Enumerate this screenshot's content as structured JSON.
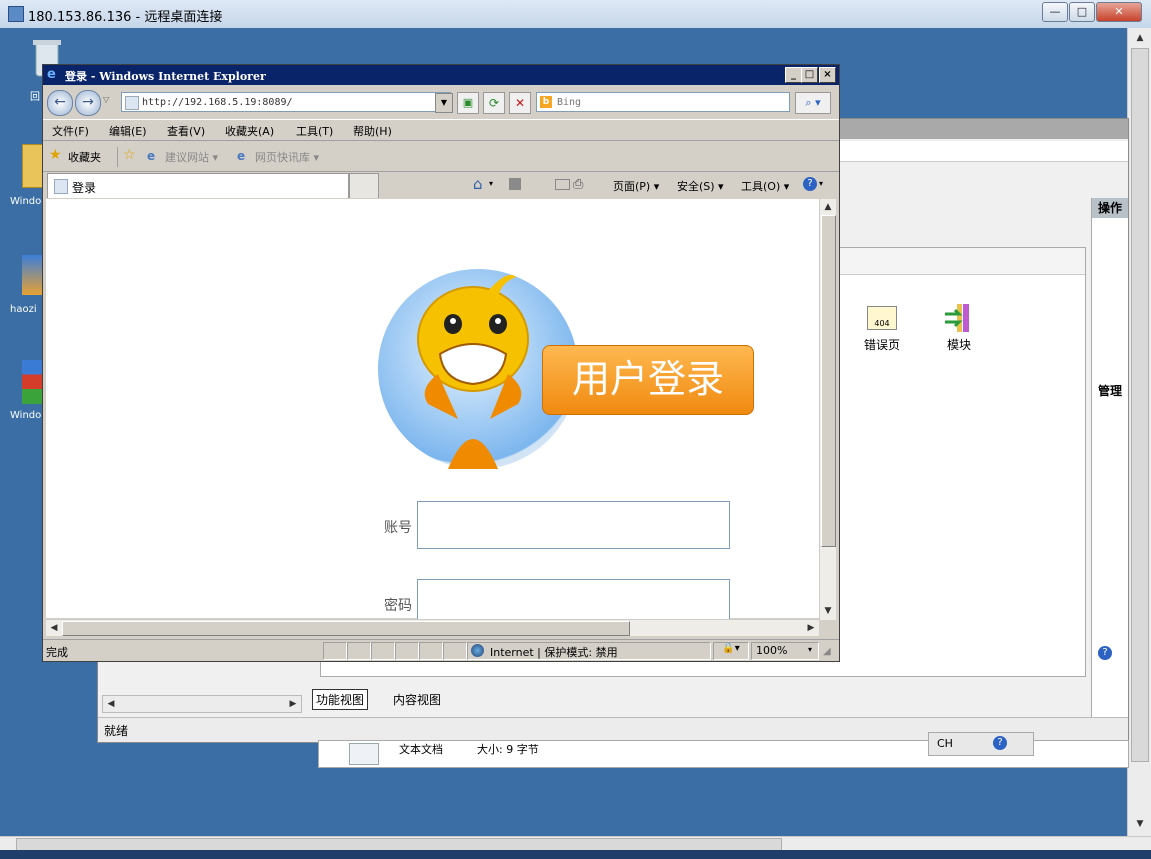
{
  "rdp": {
    "title": "180.153.86.136 - 远程桌面连接",
    "buttons": [
      "—",
      "□",
      "✕"
    ]
  },
  "desktop": {
    "icons": [
      {
        "name": "recycle-bin",
        "label": "回"
      },
      {
        "name": "folder",
        "label": "Windo"
      },
      {
        "name": "haozip",
        "label": "haozi"
      },
      {
        "name": "winrar",
        "label": "Windo"
      }
    ]
  },
  "iis": {
    "panel_title_actions": "操作",
    "panel_manage": "管理",
    "icons": [
      {
        "label": "错误页",
        "badge": "404"
      },
      {
        "label": "模块"
      }
    ],
    "view_tabs": [
      "功能视图",
      "内容视图"
    ],
    "status": "就绪",
    "file_row": {
      "name": "文本文档",
      "size": "大小: 9 字节"
    },
    "lang": "CH"
  },
  "ie": {
    "title": "登录 - Windows Internet Explorer",
    "address": "http://192.168.5.19:8089/",
    "search_placeholder": "Bing",
    "menu": [
      "文件(F)",
      "编辑(E)",
      "查看(V)",
      "收藏夹(A)",
      "工具(T)",
      "帮助(H)"
    ],
    "favorites_label": "收藏夹",
    "fav_links": [
      "建议网站 ▾",
      "网页快讯库 ▾"
    ],
    "tab_title": "登录",
    "cmd_items": [
      "页面(P) ▾",
      "安全(S) ▾",
      "工具(O) ▾"
    ],
    "status_left": "完成",
    "zone": "Internet | 保护模式: 禁用",
    "zoom": "100%"
  },
  "page": {
    "banner_text": "用户登录",
    "account_label": "账号",
    "password_label": "密码",
    "account_value": "",
    "password_value": ""
  }
}
